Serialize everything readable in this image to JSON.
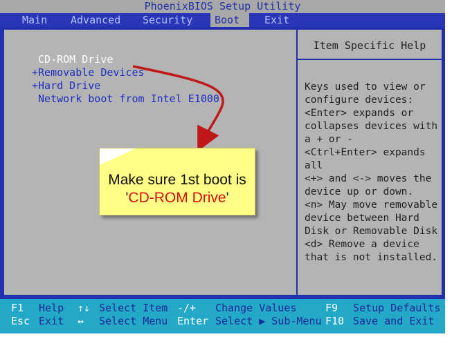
{
  "window_title": "PhoenixBIOS Setup Utility",
  "menu": [
    {
      "label": "Main"
    },
    {
      "label": "Advanced"
    },
    {
      "label": "Security"
    },
    {
      "label": "Boot",
      "active": true
    },
    {
      "label": "Exit"
    }
  ],
  "boot_list": [
    {
      "label": " CD-ROM Drive",
      "selected": true
    },
    {
      "label": "+Removable Devices"
    },
    {
      "label": "+Hard Drive"
    },
    {
      "label": " Network boot from Intel E1000"
    }
  ],
  "help": {
    "title": "Item Specific Help",
    "lines": [
      "Keys used to view or",
      "configure devices:",
      "<Enter> expands or",
      "collapses devices with",
      "a + or -",
      "<Ctrl+Enter> expands",
      "all",
      "<+> and <-> moves the",
      "device up or down.",
      "<n> May move removable",
      "device between Hard",
      "Disk or Removable Disk",
      "<d> Remove a device",
      "that is not installed."
    ]
  },
  "footer": {
    "row1": {
      "key1": "F1",
      "desc1": "Help",
      "key2": "↑↓",
      "desc2": "Select Item",
      "key3": "-/+",
      "desc3": "Change Values",
      "key4": "F9",
      "desc4": "Setup Defaults"
    },
    "row2": {
      "key1": "Esc",
      "desc1": "Exit",
      "key2": "↔",
      "desc2": "Select Menu",
      "key3": "Enter",
      "desc3": "Select ▶ Sub-Menu",
      "key4": "F10",
      "desc4": "Save and Exit"
    }
  },
  "callout": {
    "line1": "Make sure 1st boot is",
    "quote_open": "'",
    "highlight": "CD-ROM Drive",
    "quote_close": "'"
  },
  "colors": {
    "screen_blue": "#2030b0",
    "panel_gray": "#b4b4b4",
    "footer_cyan": "#23a8c8",
    "callout_yellow": "#ffff88",
    "arrow_red": "#c01818"
  }
}
